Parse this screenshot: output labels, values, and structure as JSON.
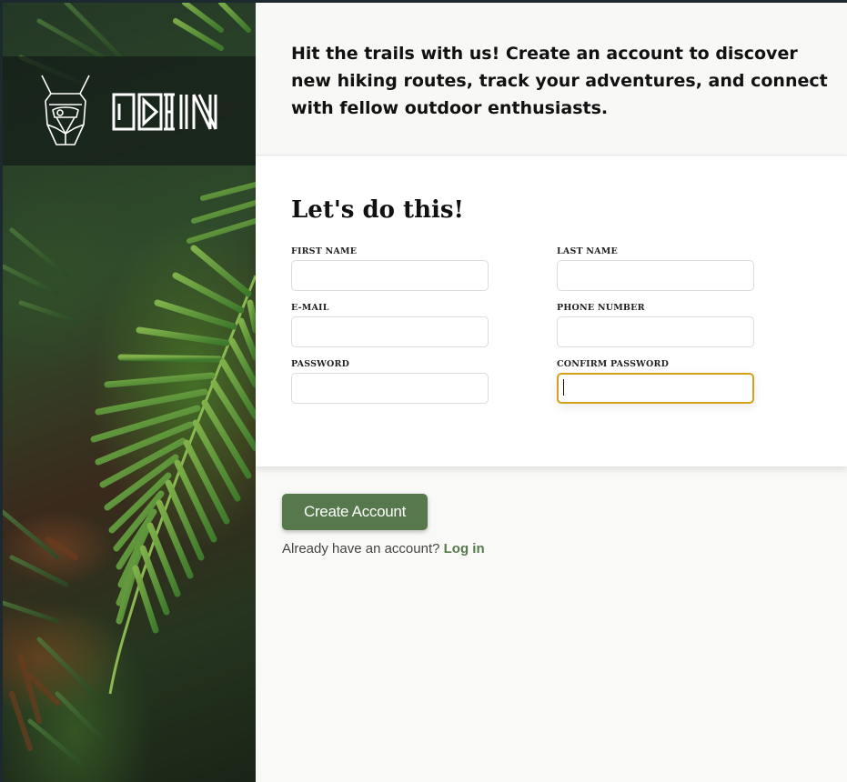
{
  "brand": {
    "name": "ODIN",
    "logo_icon": "viking-helmet-icon"
  },
  "intro": {
    "text": "Hit the trails with us! Create an account to discover new hiking routes, track your adventures, and connect with fellow outdoor enthusiasts."
  },
  "form": {
    "heading": "Let's do this!",
    "fields": {
      "first_name": {
        "label": "First Name",
        "value": "",
        "placeholder": ""
      },
      "last_name": {
        "label": "Last Name",
        "value": "",
        "placeholder": ""
      },
      "email": {
        "label": "E-mail",
        "value": "",
        "placeholder": ""
      },
      "phone": {
        "label": "Phone Number",
        "value": "",
        "placeholder": ""
      },
      "password": {
        "label": "Password",
        "value": "",
        "placeholder": ""
      },
      "confirm_password": {
        "label": "Confirm Password",
        "value": "",
        "placeholder": "",
        "focused": true
      }
    }
  },
  "actions": {
    "create_account_label": "Create Account",
    "login_prompt": "Already have an account?",
    "login_link": "Log in"
  },
  "colors": {
    "accent_green": "#56784c",
    "focus_border": "#d4a21a",
    "page_background": "#f9f9f7"
  }
}
